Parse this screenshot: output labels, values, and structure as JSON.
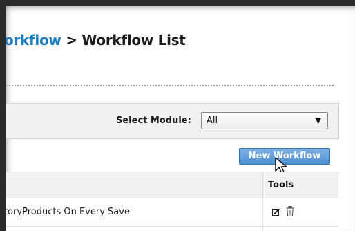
{
  "breadcrumb": {
    "parent": "orkflow",
    "separator": " > ",
    "current": "Workflow List"
  },
  "module_filter": {
    "label": "Select Module:",
    "selected": "All"
  },
  "new_workflow_button": "New Workflow",
  "table": {
    "columns": {
      "tools": "Tools"
    },
    "rows": [
      {
        "name": "toryProducts On Every Save"
      }
    ]
  },
  "colors": {
    "link": "#1d7dbf",
    "button": "#5f9ad8",
    "panel": "#f1f1f1"
  }
}
